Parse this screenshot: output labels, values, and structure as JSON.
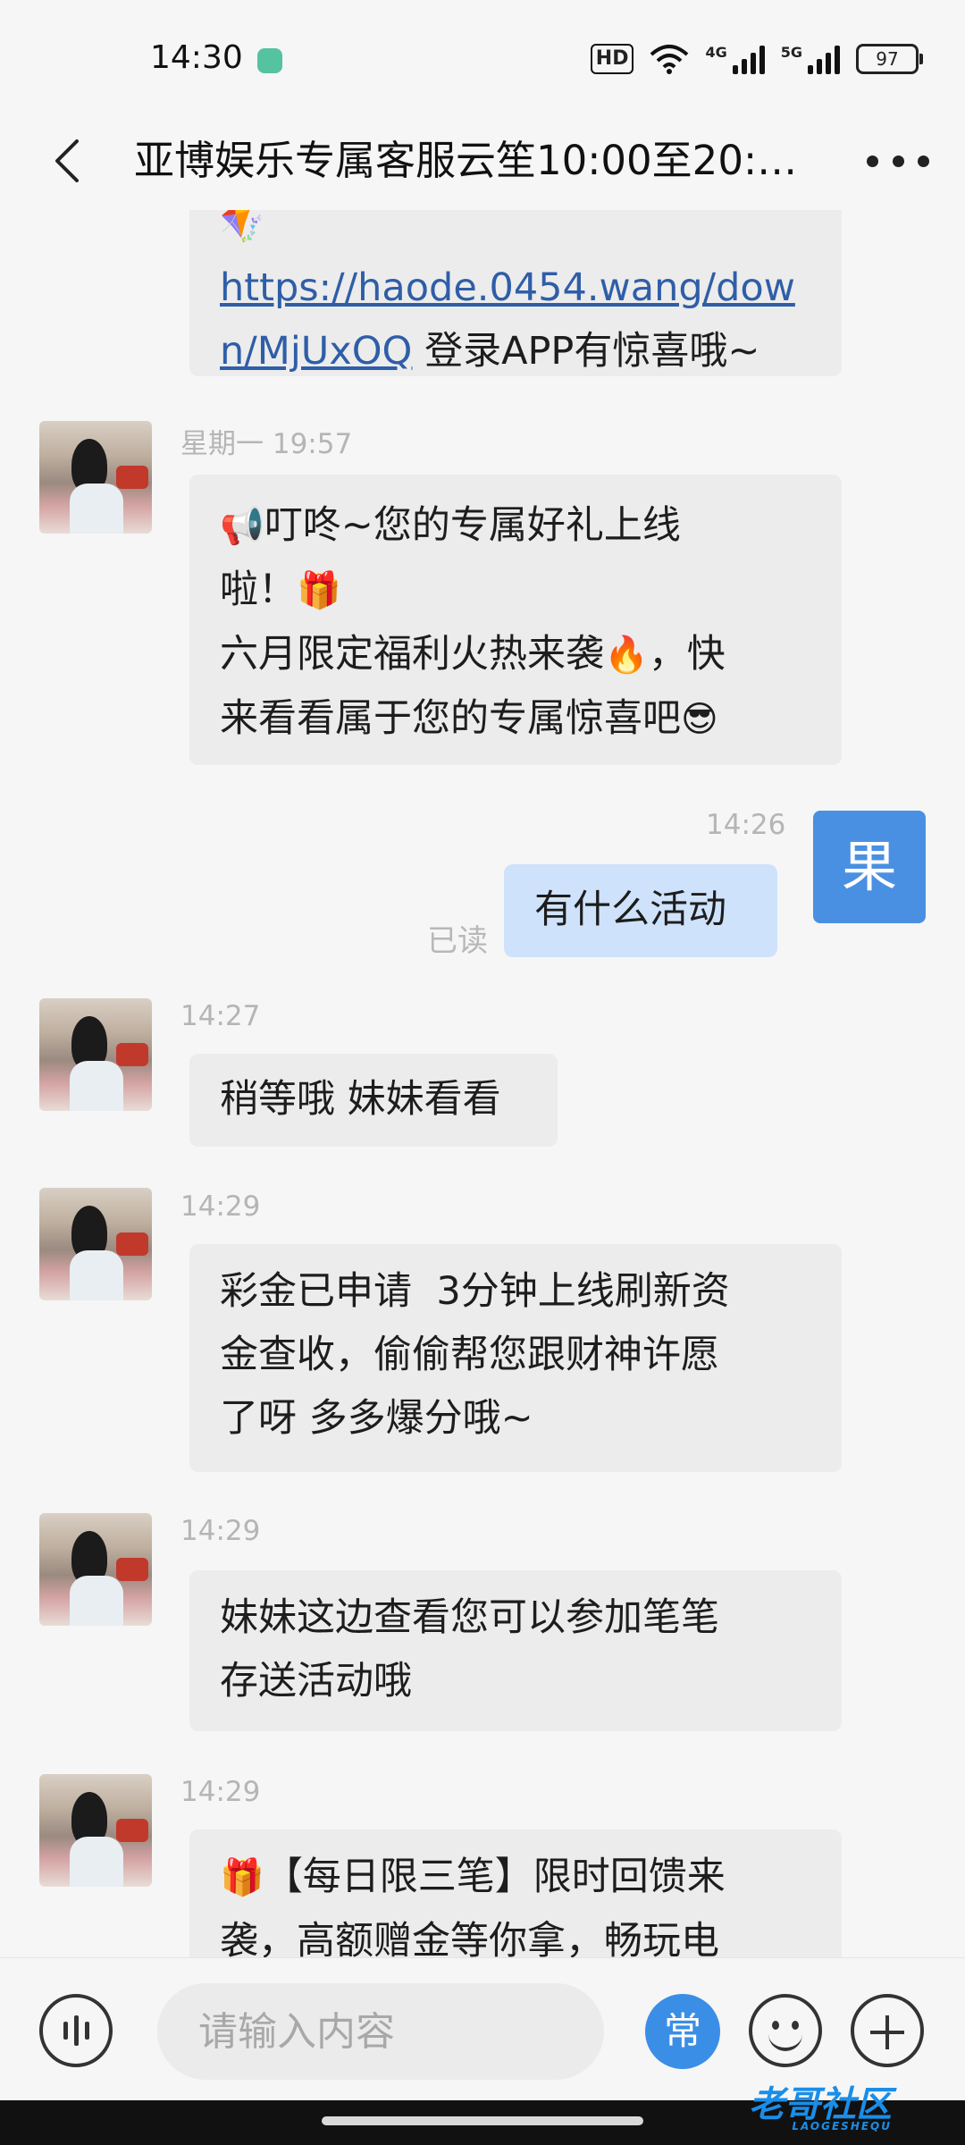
{
  "status_bar": {
    "time": "14:30",
    "hd_label": "HD",
    "net1_label": "4G",
    "net2_label": "5G",
    "battery": "97"
  },
  "header": {
    "title": "亚博娱乐专属客服云笙10:00至20:…"
  },
  "messages": {
    "m0": {
      "link": "https://haode.0454.wang/down/MjUxOQ",
      "link_line1": "https://haode.0454.wang/dow",
      "link_line2": "n/MjUxOQ",
      "suffix": " 登录APP有惊喜哦~",
      "top_emoji": "🪁"
    },
    "m1": {
      "time": "星期一 19:57",
      "l1_emoji": "📢",
      "l1": "叮咚~您的专属好礼上线",
      "l2": "啦！",
      "l2_emoji": "🎁",
      "l3": "六月限定福利火热来袭",
      "l3_emoji": "🔥",
      "l3_tail": "，快",
      "l4": "来看看属于您的专属惊喜吧",
      "l4_emoji": "😎"
    },
    "m2": {
      "time": "14:26",
      "text": "有什么活动",
      "read": "已读",
      "avatar_char": "果"
    },
    "m3": {
      "time": "14:27",
      "text": "稍等哦 妹妹看看"
    },
    "m4": {
      "time": "14:29",
      "l1": "彩金已申请  3分钟上线刷新资",
      "l2": "金查收，偷偷帮您跟财神许愿",
      "l3": "了呀 多多爆分哦~"
    },
    "m5": {
      "time": "14:29",
      "l1": "妹妹这边查看您可以参加笔笔",
      "l2": "存送活动哦"
    },
    "m6": {
      "time": "14:29",
      "emoji": "🎁",
      "l1": "【每日限三笔】限时回馈来",
      "l2": "袭，高额赠金等你拿，畅玩电"
    }
  },
  "input_bar": {
    "placeholder": "请输入内容",
    "common_label": "常"
  },
  "watermark": {
    "text": "老哥社区",
    "sub": "LAOGESHEQU"
  }
}
